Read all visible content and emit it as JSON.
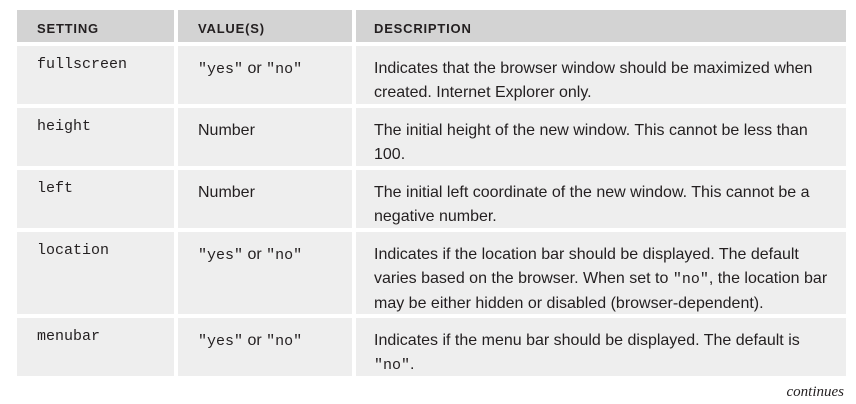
{
  "header": {
    "col1": "SETTING",
    "col2": "VALUE(S)",
    "col3": "DESCRIPTION"
  },
  "rows": [
    {
      "setting": "fullscreen",
      "value_code1": "\"yes\"",
      "value_or": " or ",
      "value_code2": "\"no\"",
      "description": "Indicates that the browser window should be maximized when created. Internet Explorer only."
    },
    {
      "setting": "height",
      "value": "Number",
      "description": "The initial height of the new window. This cannot be less than 100."
    },
    {
      "setting": "left",
      "value": "Number",
      "description": "The initial left coordinate of the new window. This cannot be a negative number."
    },
    {
      "setting": "location",
      "value_code1": "\"yes\"",
      "value_or": " or ",
      "value_code2": "\"no\"",
      "description_part1": "Indicates if the location bar should be displayed. The default varies based on the browser. When set to ",
      "description_code": "\"no\"",
      "description_part2": ", the location bar may be either hidden or disabled (browser-dependent)."
    },
    {
      "setting": "menubar",
      "value_code1": "\"yes\"",
      "value_or": " or ",
      "value_code2": "\"no\"",
      "description_part1": "Indicates if the menu bar should be displayed. The default is ",
      "description_code": "\"no\"",
      "description_part2": "."
    }
  ],
  "footer": "continues"
}
